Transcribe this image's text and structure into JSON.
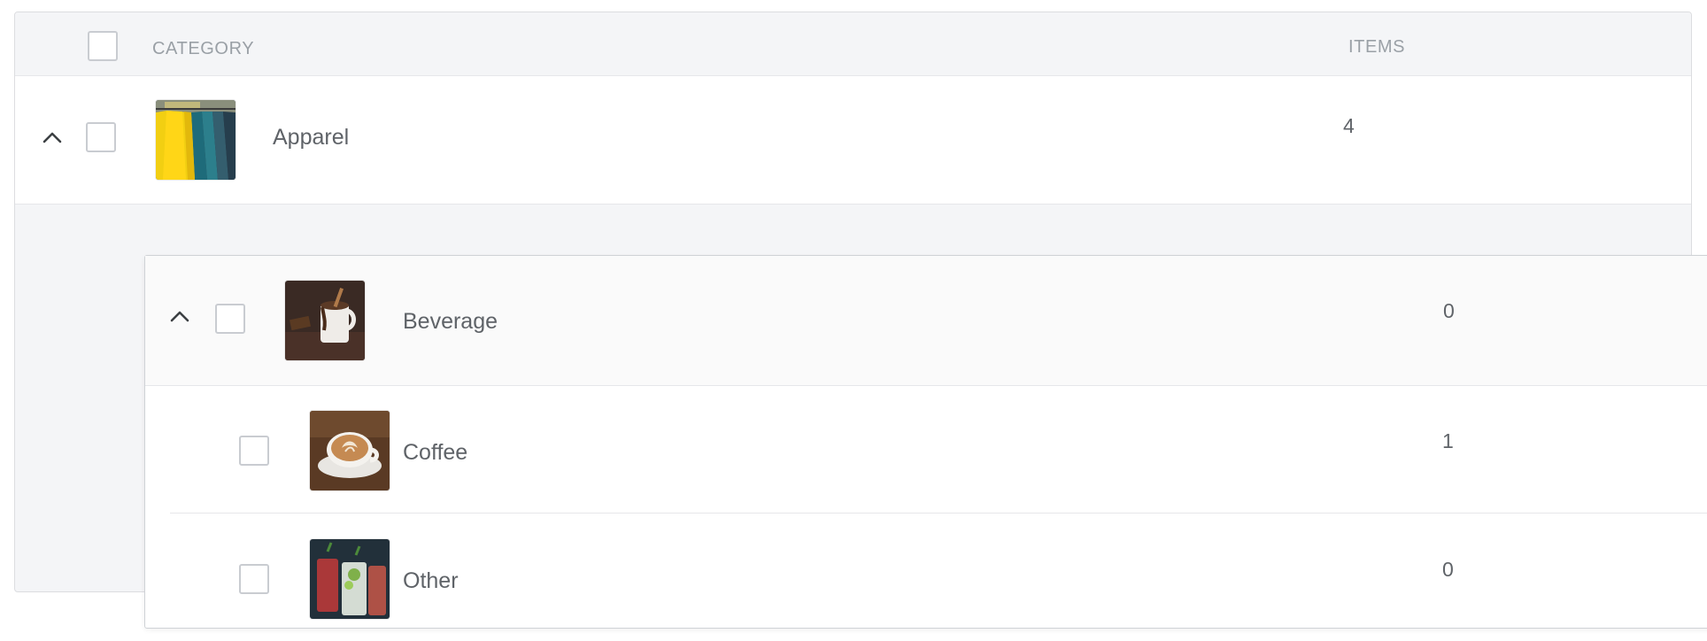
{
  "header": {
    "category_label": "CATEGORY",
    "items_label": "ITEMS"
  },
  "rows": [
    {
      "name": "Apparel",
      "items": "4",
      "expanded": true,
      "thumb_icon": "clothing-rack-photo",
      "children": [
        {
          "name": "Beverage",
          "items": "0",
          "expanded": true,
          "thumb_icon": "hot-chocolate-photo",
          "children": [
            {
              "name": "Coffee",
              "items": "1",
              "thumb_icon": "latte-art-photo"
            },
            {
              "name": "Other",
              "items": "0",
              "thumb_icon": "cocktail-photo"
            }
          ]
        }
      ]
    }
  ],
  "icons": {
    "expand": "chevron-up-icon",
    "select": "checkbox"
  },
  "colors": {
    "header_bg": "#f4f5f7",
    "text": "#5f6368",
    "header_text": "#9aa0a6",
    "border": "#dcdde0"
  }
}
